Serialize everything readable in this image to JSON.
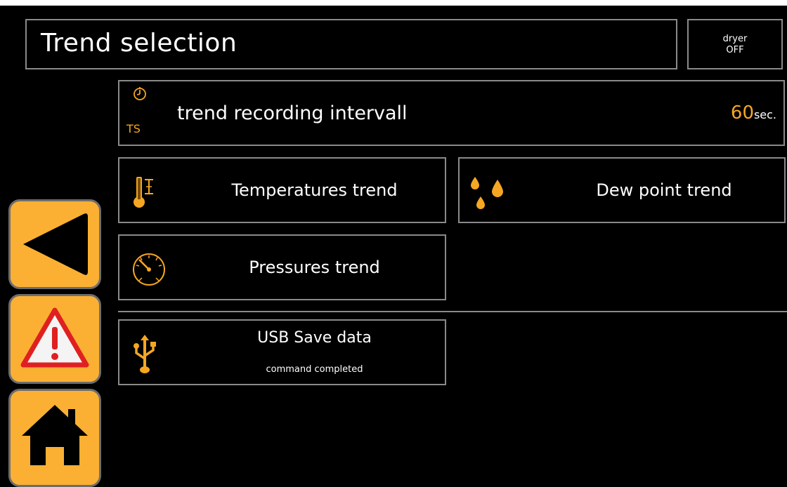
{
  "header": {
    "title": "Trend selection",
    "status_line1": "dryer",
    "status_line2": "OFF"
  },
  "interval": {
    "icon": "timer-icon",
    "ts_label": "TS",
    "label": "trend recording intervall",
    "value": "60",
    "unit": "sec."
  },
  "buttons": {
    "temperatures": {
      "icon": "thermometer-icon",
      "label": "Temperatures trend"
    },
    "dew_point": {
      "icon": "water-drops-icon",
      "label": "Dew point trend"
    },
    "pressures": {
      "icon": "gauge-icon",
      "label": "Pressures trend"
    },
    "usb": {
      "icon": "usb-icon",
      "label": "USB Save data",
      "status": "command completed"
    }
  },
  "sidebar": {
    "back": {
      "icon": "back-arrow-icon"
    },
    "alarm": {
      "icon": "warning-icon"
    },
    "home": {
      "icon": "home-icon"
    }
  },
  "colors": {
    "accent": "#f5a623",
    "button_fill": "#fbb033",
    "border": "#8a8a8a",
    "background": "#000000",
    "warning_red": "#e02020"
  }
}
